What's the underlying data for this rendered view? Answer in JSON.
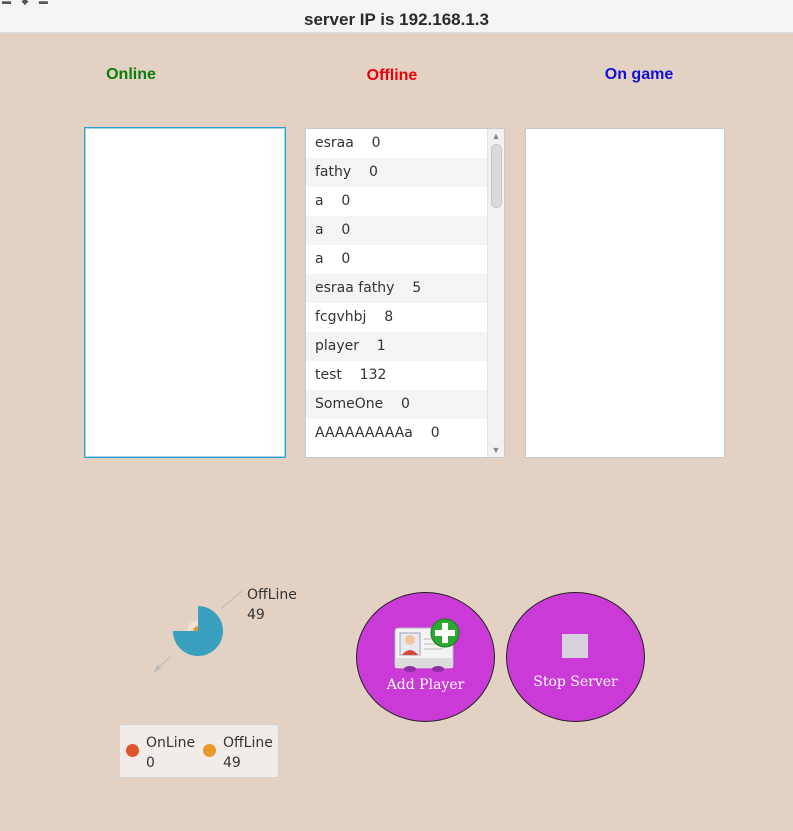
{
  "window": {
    "title": "server IP is 192.168.1.3"
  },
  "columns": {
    "online": {
      "title": "Online",
      "color": "#0a7d0a"
    },
    "offline": {
      "title": "Offline",
      "color": "#e8000a"
    },
    "on_game": {
      "title": "On game",
      "color": "#1010d8"
    }
  },
  "offline_players": [
    "esraa    0",
    "fathy    0",
    "a    0",
    "a    0",
    "a    0",
    "esraa fathy    5",
    "fcgvhbj    8",
    "player    1",
    "test    132",
    "SomeOne    0",
    "AAAAAAAAAa    0"
  ],
  "chart_data": {
    "type": "pie",
    "slices": [
      {
        "label": "OnLine",
        "value": 0,
        "color": "#e0532e"
      },
      {
        "label": "OffLine",
        "value": 49,
        "color": "#e8992a"
      }
    ],
    "pie_label": {
      "name": "OffLine",
      "value": "49"
    },
    "legend": [
      {
        "name": "OnLine",
        "value": "0"
      },
      {
        "name": "OffLine",
        "value": "49"
      }
    ]
  },
  "buttons": {
    "add_player": "Add Player",
    "stop_server": "Stop Server"
  },
  "colors": {
    "background": "#e3d1c3",
    "button": "#c93ad7",
    "pie": "#3aa0c0"
  }
}
